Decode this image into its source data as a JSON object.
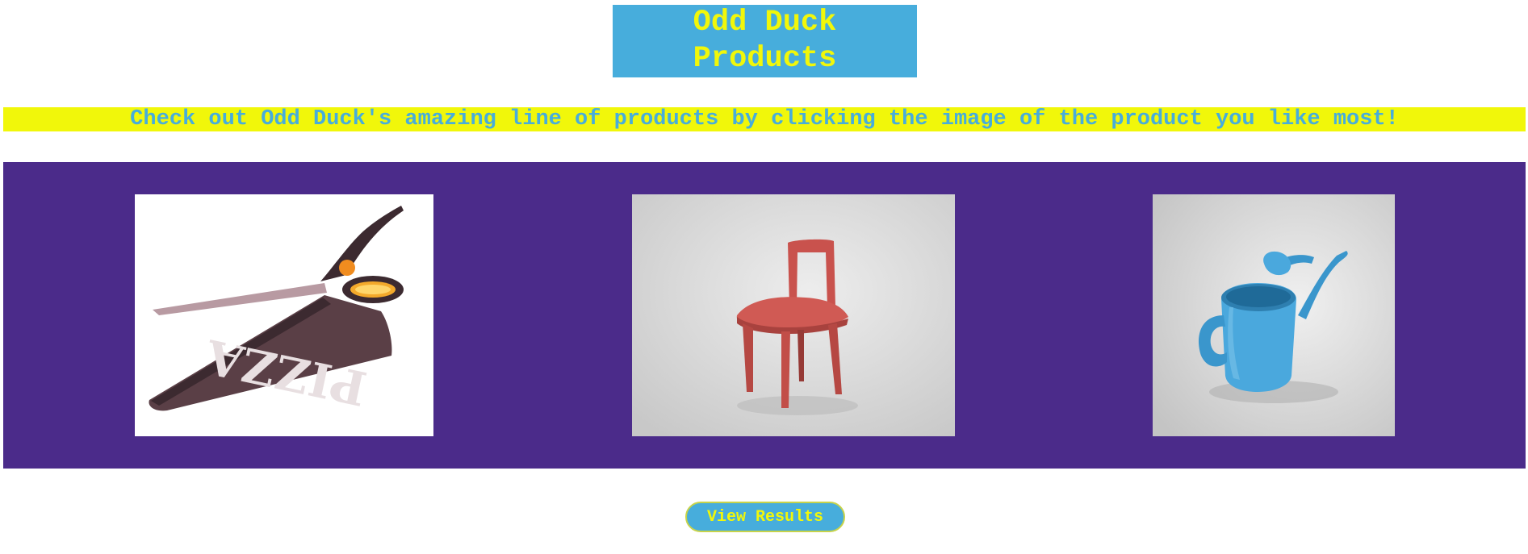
{
  "header": {
    "title": "Odd Duck\nProducts"
  },
  "intro": {
    "text": "Check out Odd Duck's amazing line of products by clicking the image of the product you like most!"
  },
  "products": [
    {
      "icon": "pizza-scissors-image"
    },
    {
      "icon": "red-chair-image"
    },
    {
      "icon": "blue-watering-can-image"
    }
  ],
  "actions": {
    "view_results_label": "View Results"
  },
  "colors": {
    "title_bg": "#47addc",
    "title_text": "#f1f70a",
    "banner_bg": "#f1f70a",
    "banner_text": "#47addc",
    "panel_bg": "#4b2b8a",
    "button_bg": "#47addc",
    "button_text": "#f1f70a"
  }
}
